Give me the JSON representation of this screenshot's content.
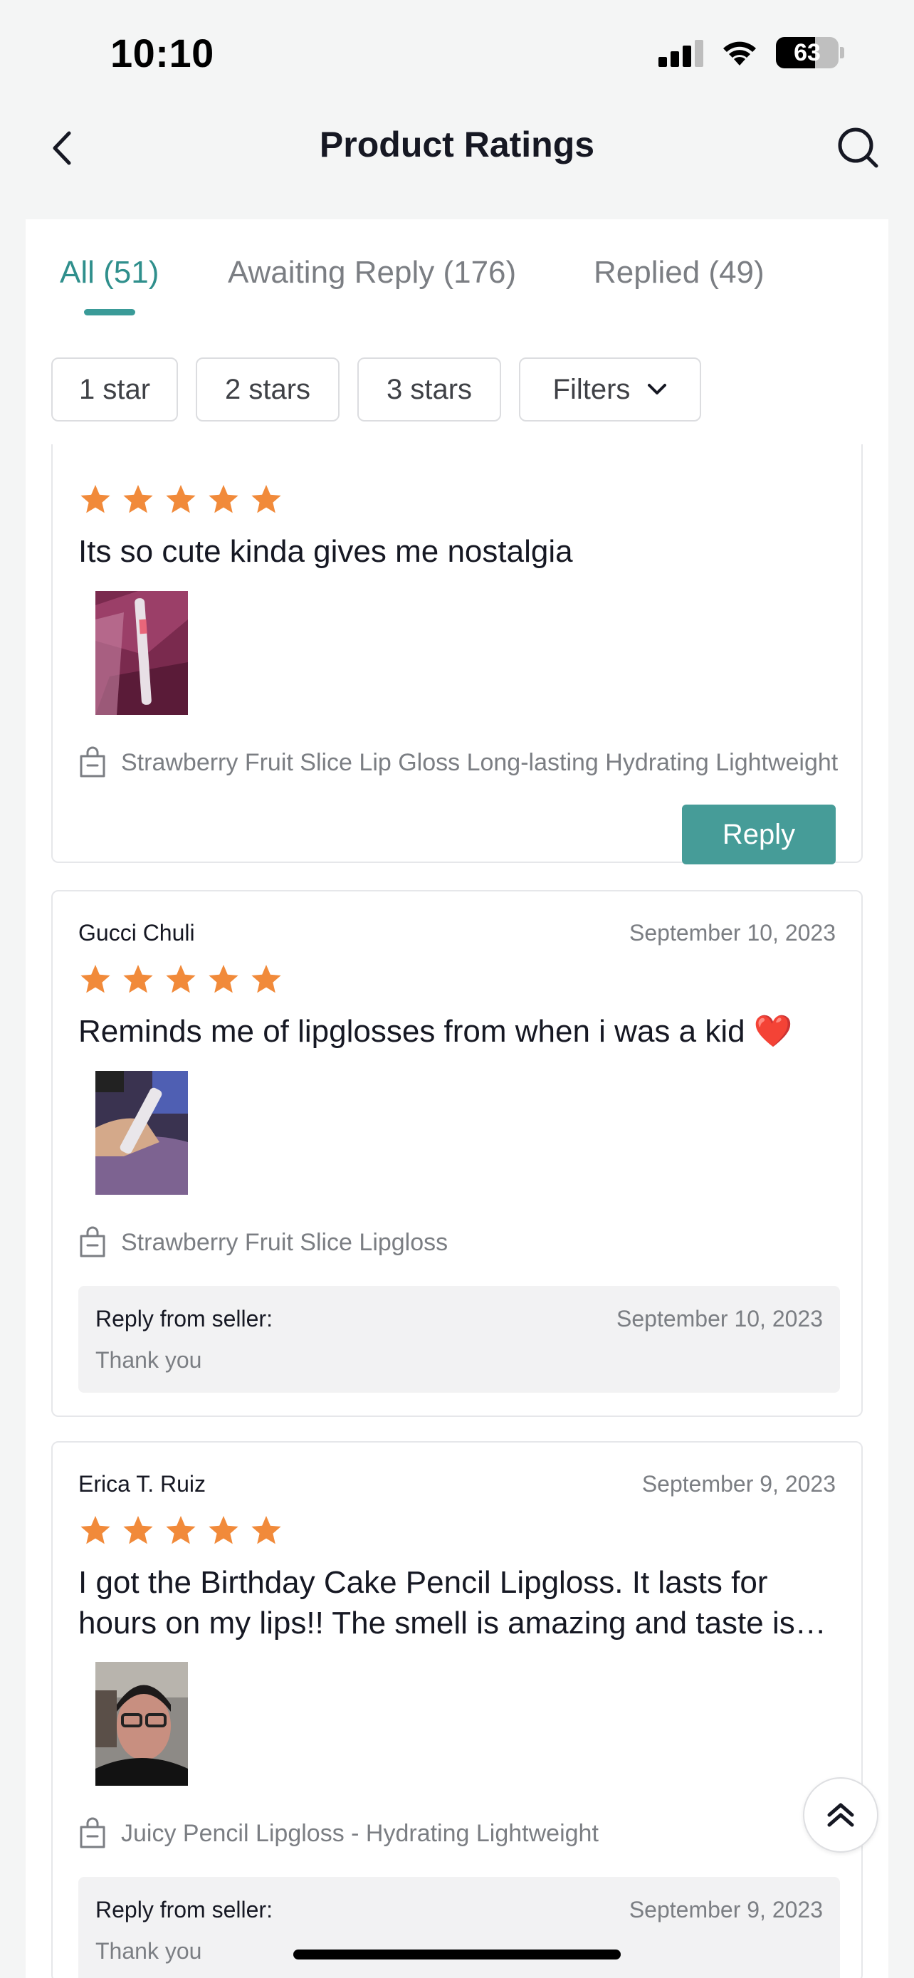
{
  "status_bar": {
    "time": "10:10",
    "battery": "63"
  },
  "nav": {
    "title": "Product Ratings"
  },
  "tabs": [
    {
      "label": "All (51)"
    },
    {
      "label": "Awaiting Reply (176)"
    },
    {
      "label": "Replied (49)"
    }
  ],
  "filters": {
    "chips": [
      "1 star",
      "2 stars",
      "3 stars"
    ],
    "filters_label": "Filters"
  },
  "reviews": [
    {
      "rating": 5,
      "text": "Its so cute kinda gives me nostalgia",
      "product": "Strawberry Fruit Slice Lip Gloss Long-lasting Hydrating Lightweight",
      "reply_button": "Reply"
    },
    {
      "name": "Gucci Chuli",
      "date": "September 10, 2023",
      "rating": 5,
      "text": "Reminds me of lipglosses from when i was a kid ❤️",
      "product": "Strawberry Fruit Slice Lipgloss",
      "seller_reply": {
        "label": "Reply from seller:",
        "date": "September 10, 2023",
        "message": "Thank you"
      }
    },
    {
      "name": "Erica T. Ruiz",
      "date": "September 9, 2023",
      "rating": 5,
      "text": "I got the Birthday Cake Pencil Lipgloss. It lasts for hours on my lips!! The smell is amazing and taste is delicious",
      "product": "Juicy Pencil Lipgloss - Hydrating Lightweight",
      "seller_reply": {
        "label": "Reply from seller:",
        "date": "September 9, 2023",
        "message": "Thank you"
      }
    }
  ],
  "colors": {
    "accent": "#3a9b98",
    "reply_button": "#469c98",
    "star": "#f18a3a"
  }
}
